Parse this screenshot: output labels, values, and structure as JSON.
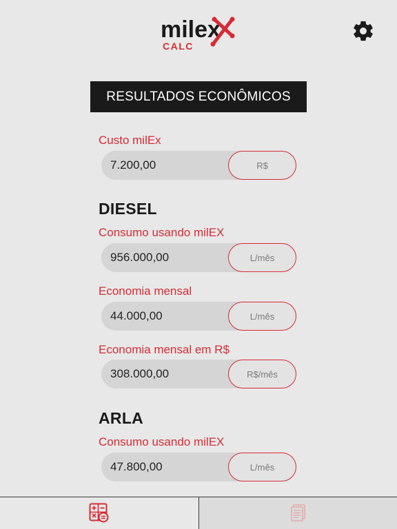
{
  "header": {
    "logo_text": "milex",
    "logo_sub": "CALC",
    "settings_icon": "gear-icon"
  },
  "title": "RESULTADOS ECONÔMICOS",
  "custo": {
    "label": "Custo milEx",
    "value": "7.200,00",
    "unit": "R$"
  },
  "diesel": {
    "heading": "DIESEL",
    "consumo": {
      "label": "Consumo usando milEX",
      "value": "956.000,00",
      "unit": "L/mês"
    },
    "economia": {
      "label": "Economia mensal",
      "value": "44.000,00",
      "unit": "L/mês"
    },
    "economia_rs": {
      "label": "Economia mensal em R$",
      "value": "308.000,00",
      "unit": "R$/mês"
    }
  },
  "arla": {
    "heading": "ARLA",
    "consumo": {
      "label": "Consumo usando milEX",
      "value": "47.800,00",
      "unit": "L/mês"
    }
  },
  "tabs": [
    {
      "icon": "calculator-icon",
      "active": true
    },
    {
      "icon": "report-icon",
      "active": false
    }
  ],
  "colors": {
    "accent": "#d62b34",
    "dark": "#1a1a1a",
    "background": "#e8e8e8"
  }
}
